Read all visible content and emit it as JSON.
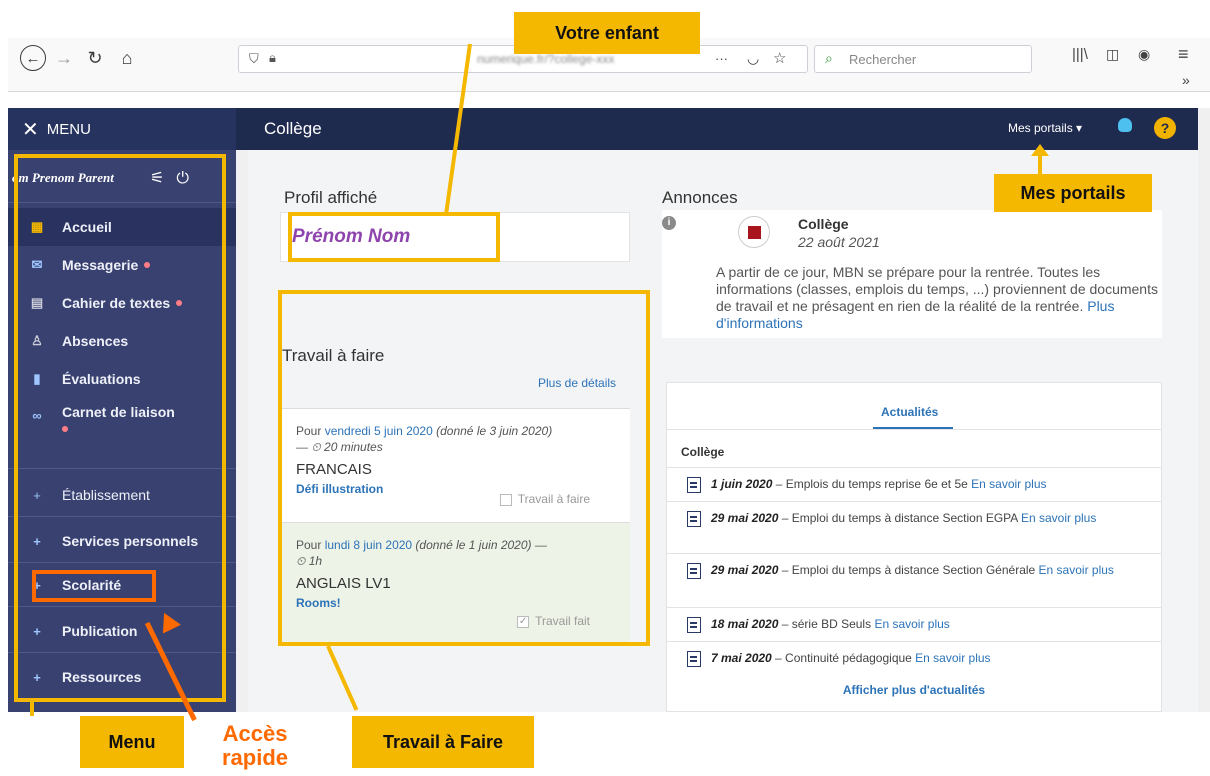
{
  "browser": {
    "url": "numerique.fr/?college-xxx",
    "search_placeholder": "Rechercher",
    "url_actions": "···"
  },
  "app": {
    "menu_label": "MENU",
    "title": "Collège",
    "portals_label": "Mes portails ▾",
    "help_label": "?"
  },
  "sidebar": {
    "user": "om Prenom Parent",
    "items": [
      {
        "label": "Accueil",
        "icon": "▦",
        "dot": false
      },
      {
        "label": "Messagerie",
        "icon": "✉",
        "dot": true
      },
      {
        "label": "Cahier de textes",
        "icon": "▤",
        "dot": true
      },
      {
        "label": "Absences",
        "icon": "♙",
        "dot": false
      },
      {
        "label": "Évaluations",
        "icon": "▮",
        "dot": false
      },
      {
        "label": "Carnet de liaison",
        "icon": "∞",
        "dot": true
      },
      {
        "label": "Établissement",
        "icon": "+",
        "dot": false
      },
      {
        "label": "Services personnels",
        "icon": "+",
        "dot": false
      },
      {
        "label": "Scolarité",
        "icon": "+",
        "dot": false
      },
      {
        "label": "Publication",
        "icon": "+",
        "dot": false
      },
      {
        "label": "Ressources",
        "icon": "+",
        "dot": false
      }
    ]
  },
  "profile": {
    "label": "Profil affiché",
    "name": "Prénom Nom"
  },
  "todo": {
    "title": "Travail à faire",
    "more": "Plus de détails",
    "cards": [
      {
        "prefix": "Pour ",
        "date": "vendredi 5 juin 2020",
        "given": " (donné le 3 juin 2020)",
        "duration": "— ⏲ 20 minutes",
        "subject": "FRANCAIS",
        "task": "Défi illustration",
        "status": "Travail à faire",
        "check": ""
      },
      {
        "prefix": "Pour ",
        "date": "lundi 8 juin 2020",
        "given": " (donné le 1 juin 2020) —",
        "duration": "⏲ 1h",
        "subject": "ANGLAIS LV1",
        "task": "Rooms!",
        "status": "Travail fait",
        "check": "✓"
      }
    ]
  },
  "announcements": {
    "title": "Annonces",
    "info_icon": "i",
    "source": "Collège",
    "date": "22 août 2021",
    "body": "A partir de ce jour, MBN se prépare pour la rentrée. Toutes les informations (classes, emplois du temps, ...) proviennent de documents de travail et ne présagent en rien de la réalité de la rentrée. ",
    "link": "Plus d'informations"
  },
  "news": {
    "tab": "Actualités",
    "group": "Collège",
    "items": [
      {
        "date": "1 juin 2020",
        "text": " – Emplois du temps reprise 6e et 5e ",
        "link": "En savoir plus"
      },
      {
        "date": "29 mai 2020",
        "text": " – Emploi du temps à distance Section EGPA ",
        "link": "En savoir plus"
      },
      {
        "date": "29 mai 2020",
        "text": " – Emploi du temps à distance Section Générale ",
        "link": "En savoir plus"
      },
      {
        "date": "18 mai 2020",
        "text": " – série BD Seuls ",
        "link": "En savoir plus"
      },
      {
        "date": "7 mai 2020",
        "text": " – Continuité pédagogique ",
        "link": "En savoir plus"
      }
    ],
    "more": "Afficher plus d'actualités"
  },
  "callouts": {
    "child": "Votre enfant",
    "portals": "Mes portails",
    "menu": "Menu",
    "quick_1": "Accès",
    "quick_2": "rapide",
    "todo": "Travail à Faire"
  },
  "colors": {
    "navy": "#1f2a4f",
    "sidebar": "#394170",
    "highlight": "#f5b800",
    "quick_access": "#ff6a00",
    "link": "#2c73b8"
  }
}
